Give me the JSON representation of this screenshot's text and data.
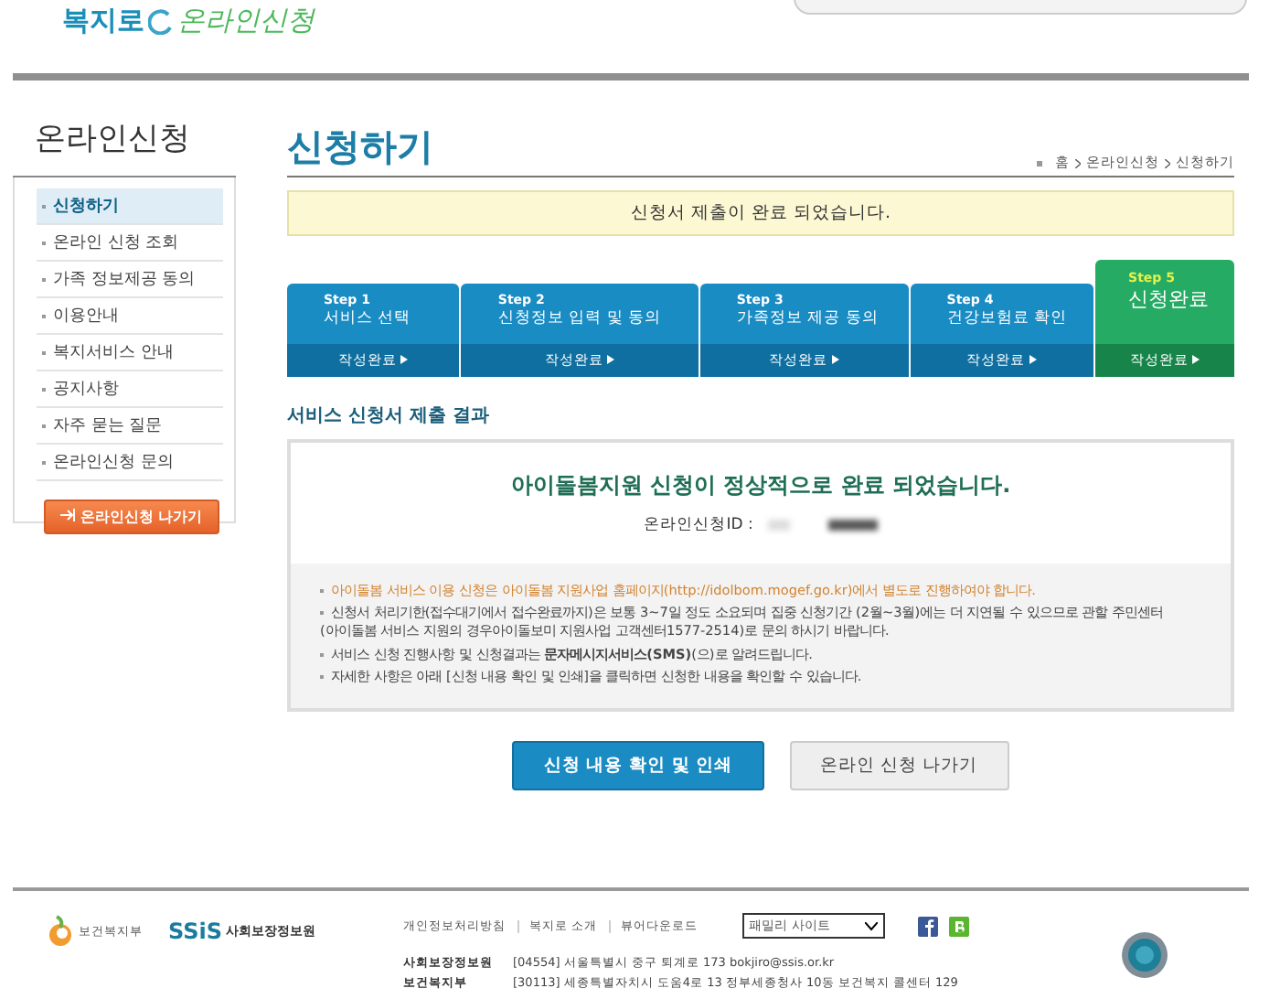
{
  "header": {
    "logo_main": "복지로",
    "logo_sub": "온라인신청"
  },
  "sidebar": {
    "title": "온라인신청",
    "items": [
      {
        "label": "신청하기",
        "selected": true
      },
      {
        "label": "온라인 신청 조회",
        "selected": false
      },
      {
        "label": "가족 정보제공 동의",
        "selected": false
      },
      {
        "label": "이용안내",
        "selected": false
      },
      {
        "label": "복지서비스 안내",
        "selected": false
      },
      {
        "label": "공지사항",
        "selected": false
      },
      {
        "label": "자주 묻는 질문",
        "selected": false
      },
      {
        "label": "온라인신청 문의",
        "selected": false
      }
    ],
    "exit_button": "온라인신청 나가기"
  },
  "page": {
    "title": "신청하기",
    "breadcrumb": [
      "홈",
      "온라인신청",
      "신청하기"
    ],
    "notice": "신청서 제출이 완료 되었습니다."
  },
  "steps": [
    {
      "step": "Step 1",
      "name": "서비스 선택",
      "status": "작성완료",
      "selected": false
    },
    {
      "step": "Step 2",
      "name": "신청정보 입력 및 동의",
      "status": "작성완료",
      "selected": false
    },
    {
      "step": "Step 3",
      "name": "가족정보 제공 동의",
      "status": "작성완료",
      "selected": false
    },
    {
      "step": "Step 4",
      "name": "건강보험료 확인",
      "status": "작성완료",
      "selected": false
    },
    {
      "step": "Step 5",
      "name": "신청완료",
      "status": "작성완료",
      "selected": true
    }
  ],
  "result": {
    "section_title": "서비스 신청서 제출 결과",
    "message": "아이돌봄지원 신청이 정상적으로 완료 되었습니다.",
    "id_label": "온라인신청ID :",
    "notes": [
      {
        "kind": "highlight",
        "lines": [
          "아이돌봄 서비스 이용 신청은 아이돌봄 지원사업 홈페이지(http://idolbom.mogef.go.kr)에서 별도로 진행하여야 합니다."
        ]
      },
      {
        "kind": "normal",
        "lines": [
          "신청서 처리기한(접수대기에서 접수완료까지)은 보통 3~7일 정도 소요되며 집중 신청기간 (2월~3월)에는 더 지연될 수 있으므로 관할 주민센터",
          "(아이돌봄 서비스 지원의 경우아이돌보미 지원사업 고객센터1577-2514)로 문의 하시기 바랍니다."
        ]
      },
      {
        "kind": "normal",
        "lines": [
          "서비스 신청 진행사항 및 신청결과는 **문자메시지서비스(SMS)**(으)로 알려드립니다."
        ]
      },
      {
        "kind": "normal",
        "lines": [
          "자세한 사항은 아래 [신청 내용 확인 및 인쇄]을 클릭하면 신청한 내용을 확인할 수 있습니다."
        ]
      }
    ]
  },
  "buttons": [
    {
      "label": "신청 내용 확인 및 인쇄",
      "kind": "primary"
    },
    {
      "label": "온라인 신청 나가기",
      "kind": "secondary"
    }
  ],
  "footer": {
    "ministry": "보건복지부",
    "agency_logo": "SSiS",
    "agency": "사회보장정보원",
    "links": [
      "개인정보처리방침",
      "복지로 소개",
      "뷰어다운로드"
    ],
    "family_site": "패밀리 사이트",
    "addresses": [
      {
        "org": "사회보장정보원",
        "address": "[04554] 서울특별시 중구 퇴계로 173  bokjiro@ssis.or.kr"
      },
      {
        "org": "보건복지부",
        "address": "[30113] 세종특별자치시 도움4로 13 정부세종청사 10동    보건복지 콜센터 129"
      }
    ]
  }
}
